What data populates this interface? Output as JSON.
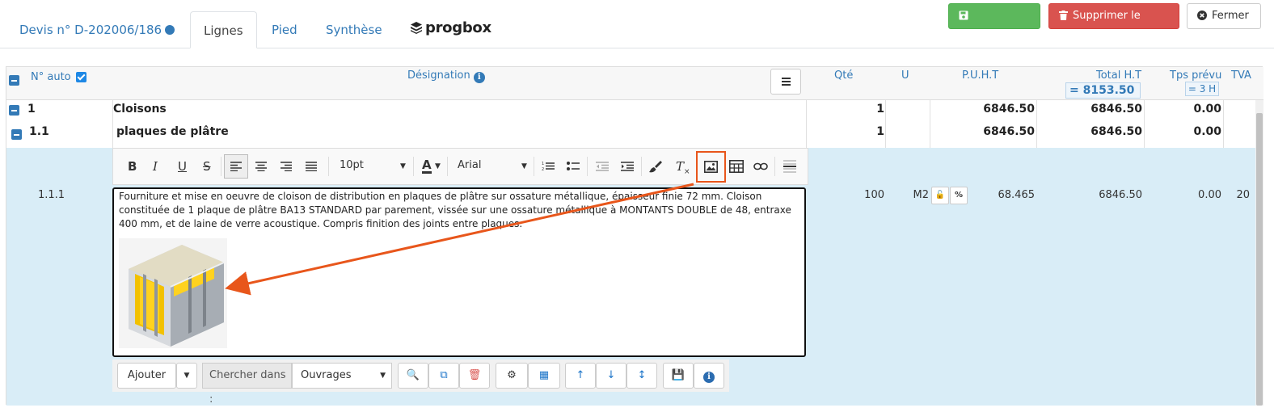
{
  "tabs": {
    "devis": "Devis n° D-202006/186",
    "lignes": "Lignes",
    "pied": "Pied",
    "synthese": "Synthèse",
    "logo": "progbox"
  },
  "actions": {
    "save": "Enregistrer",
    "delete": "Supprimer le devis",
    "close": "Fermer"
  },
  "colors": {
    "link": "#337ab7",
    "save": "#5cb85c",
    "delete": "#d9534f",
    "selected_row": "#d9edf7",
    "highlight": "#e8561b"
  },
  "header": {
    "auto_num": "N° auto",
    "designation": "Désignation",
    "qte": "Qté",
    "unit": "U",
    "puht": "P.U.H.T",
    "total_ht": "Total H.T",
    "total_ht_value": "= 8153.50",
    "tps": "Tps prévu",
    "tps_value": "= 3 H",
    "tva": "TVA"
  },
  "rows": [
    {
      "num": "1",
      "label": "Cloisons",
      "qte": "1",
      "puht": "6846.50",
      "total": "6846.50",
      "tps": "0.00"
    },
    {
      "num": "1.1",
      "label": "plaques de plâtre",
      "qte": "1",
      "puht": "6846.50",
      "total": "6846.50",
      "tps": "0.00"
    }
  ],
  "edit_row": {
    "num": "1.1.1",
    "qte": "100",
    "unit": "M2",
    "puht": "68.465",
    "total": "6846.50",
    "tps": "0.00",
    "tva": "20",
    "text": "Fourniture et mise en oeuvre de cloison de distribution en plaques de plâtre sur ossature métallique, épaisseur finie 72 mm. Cloison constituée de 1 plaque de plâtre BA13 STANDARD par parement, vissée sur une ossature métallique à MONTANTS DOUBLE de 48, entraxe 400 mm, et de laine de verre acoustique. Compris finition des joints entre plaques."
  },
  "toolbar": {
    "font_size": "10pt",
    "font_family": "Arial",
    "icons": [
      "bold-icon",
      "italic-icon",
      "underline-icon",
      "strikethrough-icon",
      "align-left-icon",
      "align-center-icon",
      "align-right-icon",
      "justify-icon",
      "numbered-list-icon",
      "bullet-list-icon",
      "outdent-icon",
      "indent-icon",
      "format-painter-icon",
      "clear-format-icon",
      "image-icon",
      "table-icon",
      "link-icon",
      "horizontal-rule-icon"
    ]
  },
  "bottom_bar": {
    "add": "Ajouter",
    "search_label": "Chercher dans :",
    "search_value": "Ouvrages",
    "icons": [
      "zoom-icon",
      "copy-icon",
      "trash-icon",
      "parts-icon",
      "calculator-icon",
      "arrow-up-icon",
      "arrow-down-icon",
      "move-icon",
      "save-icon",
      "info-icon"
    ]
  }
}
